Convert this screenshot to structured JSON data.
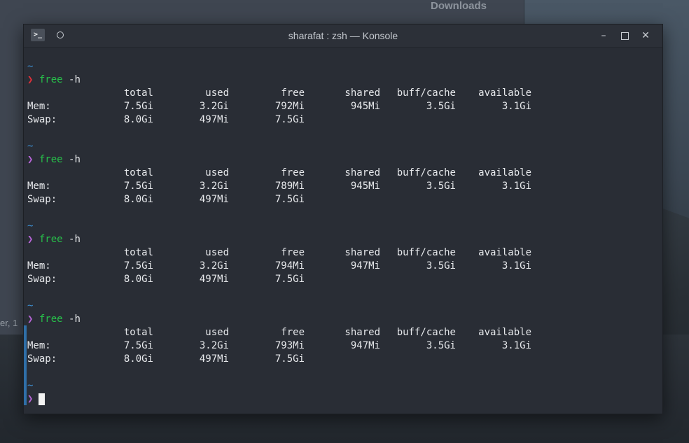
{
  "background": {
    "window_label": "Downloads",
    "truncated_text": "er, 1"
  },
  "window": {
    "title": "sharafat : zsh — Konsole",
    "app_icon_glyph": ">_",
    "controls": {
      "minimize": "–",
      "maximize": "□",
      "close": "✕"
    }
  },
  "terminal": {
    "cwd": "~",
    "prompt_char": "❯",
    "command": "free",
    "command_arg": " -h",
    "headers": [
      "total",
      "used",
      "free",
      "shared",
      "buff/cache",
      "available"
    ],
    "outputs": [
      {
        "prompt_color": "red",
        "mem": [
          "Mem:",
          "7.5Gi",
          "3.2Gi",
          "792Mi",
          "945Mi",
          "3.5Gi",
          "3.1Gi"
        ],
        "swap": [
          "Swap:",
          "8.0Gi",
          "497Mi",
          "7.5Gi"
        ]
      },
      {
        "prompt_color": "purple",
        "mem": [
          "Mem:",
          "7.5Gi",
          "3.2Gi",
          "789Mi",
          "945Mi",
          "3.5Gi",
          "3.1Gi"
        ],
        "swap": [
          "Swap:",
          "8.0Gi",
          "497Mi",
          "7.5Gi"
        ]
      },
      {
        "prompt_color": "purple",
        "mem": [
          "Mem:",
          "7.5Gi",
          "3.2Gi",
          "794Mi",
          "947Mi",
          "3.5Gi",
          "3.1Gi"
        ],
        "swap": [
          "Swap:",
          "8.0Gi",
          "497Mi",
          "7.5Gi"
        ]
      },
      {
        "prompt_color": "purple",
        "mem": [
          "Mem:",
          "7.5Gi",
          "3.2Gi",
          "793Mi",
          "947Mi",
          "3.5Gi",
          "3.1Gi"
        ],
        "swap": [
          "Swap:",
          "8.0Gi",
          "497Mi",
          "7.5Gi"
        ]
      }
    ]
  },
  "colors": {
    "tilde": "#3d8fd1",
    "prompt_error": "#e0303a",
    "prompt_ok": "#b665d6",
    "command": "#27c04a",
    "terminal_bg": "#292d35"
  }
}
